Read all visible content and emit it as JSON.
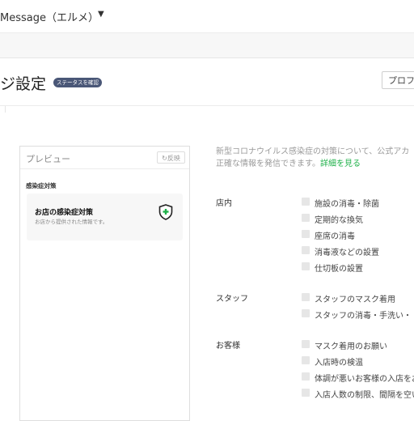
{
  "header": {
    "account_name": "Message（エルメ）",
    "dropdown_icon": "caret-down-icon"
  },
  "page": {
    "title": "ジ設定",
    "status_badge": "ステータスを確認",
    "profile_button": "プロフ"
  },
  "preview": {
    "title": "プレビュー",
    "reflect_button": "反映",
    "reflect_icon": "refresh-icon",
    "section_label": "感染症対策",
    "card": {
      "title": "お店の感染症対策",
      "subtitle": "お店から提供された情報です。",
      "icon": "shield-plus-icon",
      "icon_color": "#20b14a"
    }
  },
  "notice": {
    "line1": "新型コロナウイルス感染症の対策について、公式アカ",
    "line2": "正確な情報を発信できます。",
    "link": "詳細を見る",
    "link_color": "#20b14a"
  },
  "categories": [
    {
      "label": "店内",
      "items": [
        "施設の消毒・除菌",
        "定期的な換気",
        "座席の消毒",
        "消毒液などの設置",
        "仕切板の設置"
      ]
    },
    {
      "label": "スタッフ",
      "items": [
        "スタッフのマスク着用",
        "スタッフの消毒・手洗い・"
      ]
    },
    {
      "label": "お客様",
      "items": [
        "マスク着用のお願い",
        "入店時の検温",
        "体調が悪いお客様の入店をお",
        "入店人数の制限、間隔を空い"
      ]
    }
  ]
}
